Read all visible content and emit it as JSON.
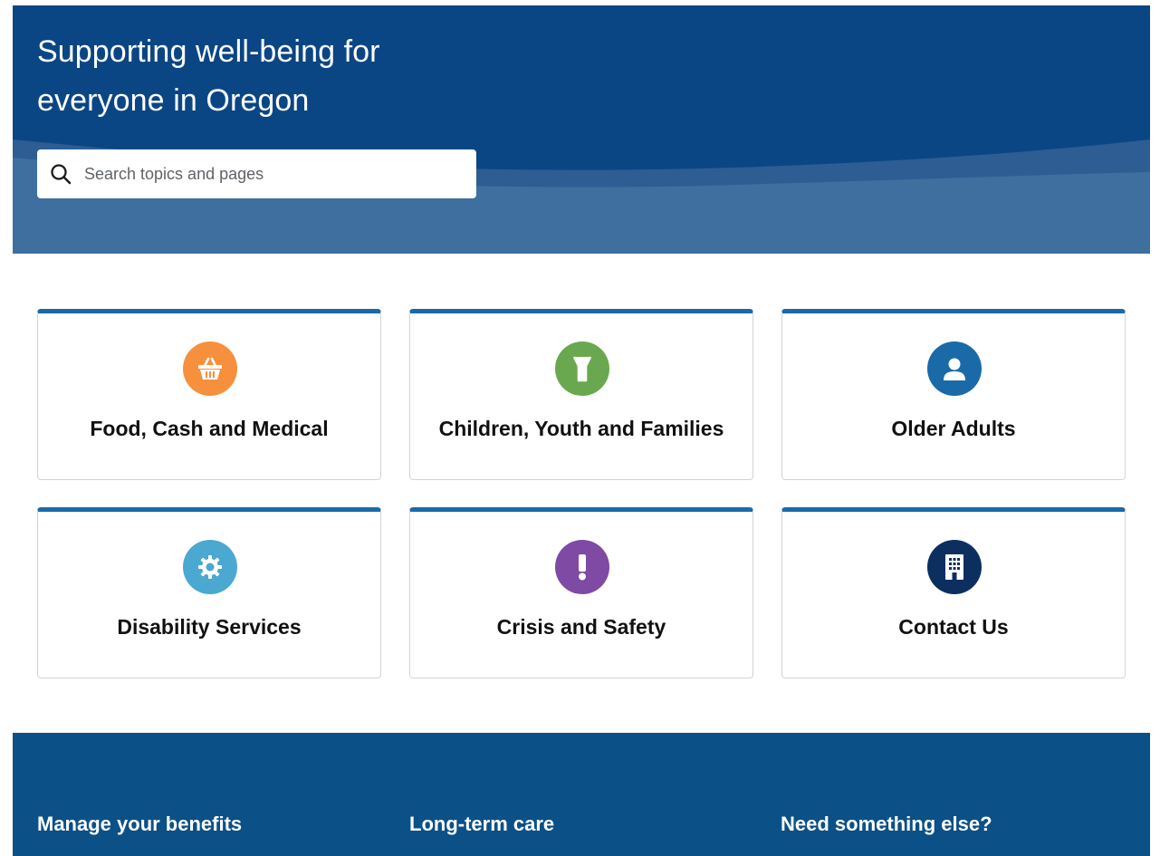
{
  "hero": {
    "title_line1": "Supporting well-being for",
    "title_line2": "everyone in Oregon",
    "search_placeholder": "Search topics and pages",
    "search_icon": "search-icon"
  },
  "cards": [
    {
      "label": "Food, Cash and Medical",
      "icon": "basket-icon",
      "color": "#f6903d"
    },
    {
      "label": "Children, Youth and Families",
      "icon": "child-icon",
      "color": "#6aa84f"
    },
    {
      "label": "Older Adults",
      "icon": "person-icon",
      "color": "#1a6aa8"
    },
    {
      "label": "Disability Services",
      "icon": "gear-icon",
      "color": "#4ba8d0"
    },
    {
      "label": "Crisis and Safety",
      "icon": "exclamation-icon",
      "color": "#7e4aa3"
    },
    {
      "label": "Contact Us",
      "icon": "building-icon",
      "color": "#0d2f60"
    }
  ],
  "colors": {
    "hero_background": "#0b4684",
    "hero_wave": "#3f6f9f",
    "card_top_border": "#1a6aa8",
    "footer_background": "#0b5086"
  },
  "footer": {
    "links": [
      {
        "label": "Manage your benefits"
      },
      {
        "label": "Long-term care"
      },
      {
        "label": "Need something else?"
      }
    ]
  }
}
